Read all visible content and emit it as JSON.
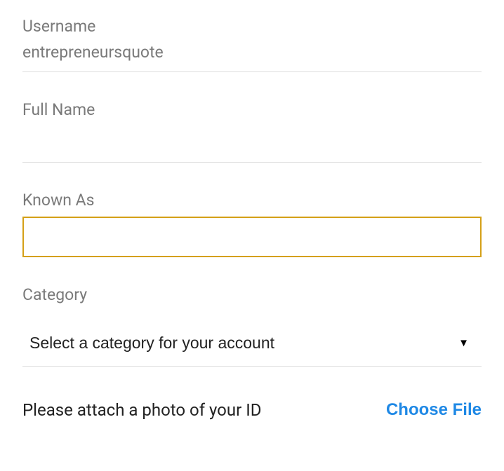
{
  "username": {
    "label": "Username",
    "value": "entrepreneursquote"
  },
  "fullname": {
    "label": "Full Name",
    "value": ""
  },
  "knownas": {
    "label": "Known As",
    "value": ""
  },
  "category": {
    "label": "Category",
    "placeholder": "Select a category for your account"
  },
  "attach": {
    "label": "Please attach a photo of your ID",
    "button": "Choose File"
  }
}
